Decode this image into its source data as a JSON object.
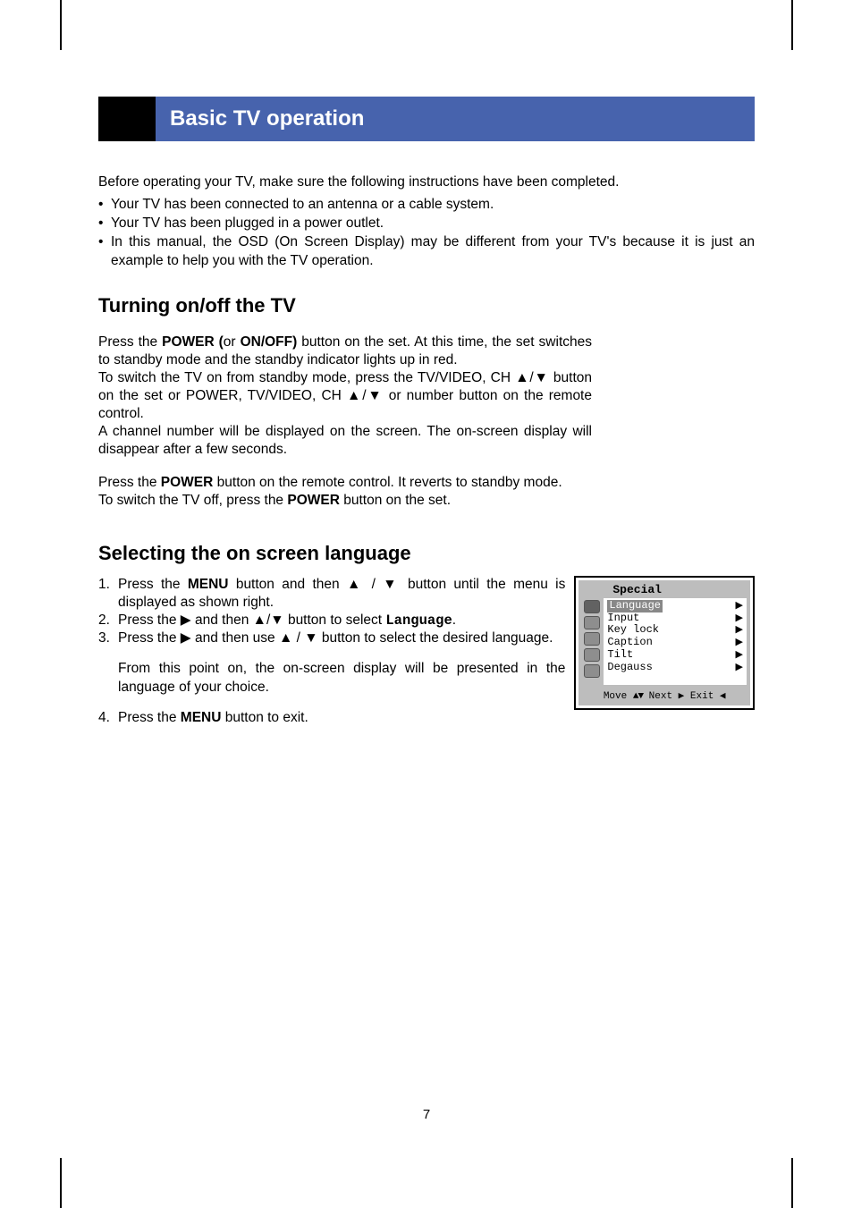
{
  "title": "Basic TV operation",
  "intro": "Before operating your TV, make sure the following instructions have been completed.",
  "bullets": [
    "Your TV has been connected to an antenna or a cable system.",
    "Your TV has been plugged in a power outlet.",
    "In this manual, the OSD (On Screen Display) may be different from your TV's because it is just an example to help you with the TV operation."
  ],
  "h_turning": "Turning on/off the TV",
  "turning": {
    "p1a": "Press the ",
    "p1b": "POWER (",
    "p1c": "or ",
    "p1d": "ON/OFF)",
    "p1e": " button on the set. At this time, the set switches to standby mode and the standby indicator lights up in red.",
    "p1f": "To switch the TV on from standby mode, press the TV/VIDEO, CH ▲/▼ button on the set or POWER, TV/VIDEO, CH ▲/▼ or number button on the remote control.",
    "p1g": "A channel number will be displayed on the screen. The on-screen display will disappear after a few seconds.",
    "p2a": "Press the ",
    "p2b": "POWER",
    "p2c": " button on the remote control. It reverts to standby mode.",
    "p2d": "To switch the TV off, press the ",
    "p2e": "POWER",
    "p2f": " button on the set."
  },
  "h_selecting": "Selecting the on screen language",
  "steps": {
    "s1a": "Press the ",
    "s1b": "MENU",
    "s1c": " button and then ▲ / ▼ button until the menu is displayed as shown right.",
    "s2a": "Press the ▶ and then ▲/▼ button to select ",
    "s2b": "Language",
    "s2c": ".",
    "s3a": "Press the ▶ and then use ▲ / ▼ button to select the desired language.",
    "s3p": "From this point on, the on-screen display will be presented in the language of your choice.",
    "s4a": "Press the ",
    "s4b": "MENU",
    "s4c": " button to exit."
  },
  "nums": {
    "n1": "1.",
    "n2": "2.",
    "n3": "3.",
    "n4": "4."
  },
  "bullet_dot": "•",
  "osd": {
    "title": "Special",
    "items": [
      "Language",
      "Input",
      "Key lock",
      "Caption",
      "Tilt",
      "Degauss"
    ],
    "footer_move": "Move",
    "footer_next": "Next",
    "footer_exit": "Exit",
    "arrow_updown": "▲▼",
    "arrow_right": "▶",
    "arrow_left": "◀",
    "tri": "▶"
  },
  "pagenum": "7"
}
